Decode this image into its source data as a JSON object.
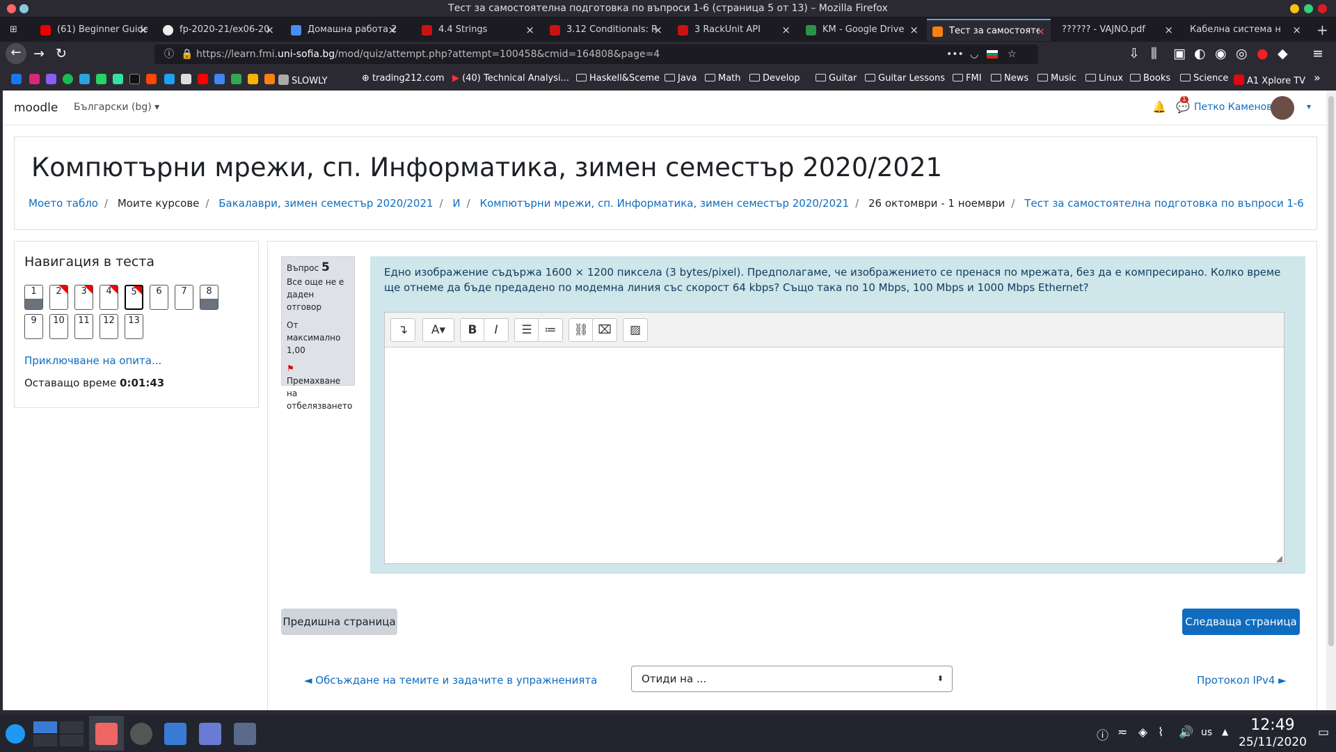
{
  "window": {
    "title": "Тест за самостоятелна подготовка по въпроси 1-6 (страница 5 от 13) – Mozilla Firefox"
  },
  "tabs": [
    {
      "label": "(61) Beginner Guide"
    },
    {
      "label": "fp-2020-21/ex06-20"
    },
    {
      "label": "Домашна работа 2"
    },
    {
      "label": "4.4 Strings"
    },
    {
      "label": "3.12 Conditionals: R"
    },
    {
      "label": "3 RackUnit API"
    },
    {
      "label": "KM - Google Drive"
    },
    {
      "label": "Тест за самостоятелна"
    },
    {
      "label": "?????? - VAJNO.pdf"
    },
    {
      "label": "Кабелна система на Л"
    }
  ],
  "url": {
    "prefix": "https://learn.fmi.",
    "domain": "uni-sofia.bg",
    "path": "/mod/quiz/attempt.php?attempt=100458&cmid=164808&page=4"
  },
  "bookmarks": {
    "slowly": "SLOWLY",
    "trading": "trading212.com",
    "ta": "(40) Technical Analysi...",
    "folders": [
      "Haskell&Sceme",
      "Java",
      "Math",
      "Develop",
      "Guitar",
      "Guitar Lessons",
      "FMI",
      "News",
      "Music",
      "Linux",
      "Books",
      "Science"
    ],
    "a1": "A1 Xplore TV"
  },
  "moodle": {
    "brand": "moodle",
    "lang": "Български (bg)",
    "user": "Петко Каменов",
    "notif_count": "1"
  },
  "course": {
    "title": "Компютърни мрежи, сп. Информатика, зимен семестър 2020/2021",
    "crumbs": [
      "Моето табло",
      "Моите курсове",
      "Бакалаври, зимен семестър 2020/2021",
      "И",
      "Компютърни мрежи, сп. Информатика, зимен семестър 2020/2021",
      "26 октомври - 1 ноември",
      "Тест за самостоятелна подготовка по въпроси 1-6"
    ]
  },
  "quiznav": {
    "title": "Навигация в теста",
    "buttons": [
      "1",
      "2",
      "3",
      "4",
      "5",
      "6",
      "7",
      "8",
      "9",
      "10",
      "11",
      "12",
      "13"
    ],
    "finish": "Приключване на опита...",
    "time_label": "Оставащо време",
    "time_value": "0:01:43"
  },
  "question": {
    "label": "Въпрос",
    "number": "5",
    "status": "Все още не е даден отговор",
    "grade": "От максимално 1,00",
    "flag": "Премахване на отбелязването",
    "text": "Едно изображение съдържа 1600 × 1200 пиксела (3 bytes/pixel). Предполагаме, че изображението се пренася по мрежата, без да е компресирано. Колко време ще отнеме да бъде предадено по модемна линия със скорост 64 kbps? Също така по 10 Mbps, 100 Mbps и 1000 Mbps Ethernet?"
  },
  "editor": {
    "b": "B",
    "i": "I",
    "a": "A"
  },
  "nav": {
    "prev": "Предишна страница",
    "next": "Следваща страница",
    "prev_activity": "◄ Обсъждане на темите и задачите в упражненията",
    "jump": "Отиди на ...",
    "next_activity": "Протокол IPv4 ►"
  },
  "taskbar": {
    "lang": "us",
    "time": "12:49",
    "date": "25/11/2020"
  }
}
